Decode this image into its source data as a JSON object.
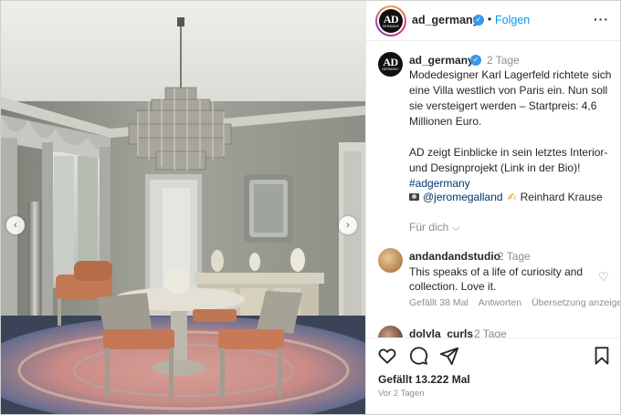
{
  "header": {
    "logo_text": "AD",
    "logo_sub": "GERMANY",
    "username": "ad_germany",
    "verified_mark": "✓",
    "separator": "•",
    "follow_label": "Folgen",
    "more_label": "···"
  },
  "media": {
    "prev_arrow": "‹",
    "next_arrow": "›"
  },
  "caption": {
    "username": "ad_germany",
    "time": "2 Tage",
    "text": "Modedesigner Karl Lagerfeld richtete sich eine Villa westlich von Paris ein. Nun soll sie versteigert werden – Startpreis: 4,6 Millionen Euro.\n\nAD zeigt Einblicke in sein letztes Interior- und Designprojekt (Link in der Bio)!",
    "hashtag": "#adgermany",
    "mention": "@jeromegalland",
    "pen_emoji": "✍",
    "credit_name": "Reinhard Krause",
    "for_you": "Für dich ⌵"
  },
  "comments": [
    {
      "username": "andandandstudio",
      "time": "2 Tage",
      "text": "This speaks of a life of curiosity and collection. Love it.",
      "heart": "♡",
      "likes": "Gefällt 38 Mal",
      "reply": "Antworten",
      "translate": "Übersetzung anzeigen"
    },
    {
      "username": "dolyla_curls",
      "time": "2 Tage"
    }
  ],
  "actions": {
    "likes": "Gefällt 13.222 Mal",
    "date": "Vor 2 Tagen"
  },
  "colors": {
    "accent": "#0095f6",
    "verified": "#3897f0",
    "link": "#00376b",
    "muted": "#8e8e8e"
  },
  "icons": [
    "heart-icon",
    "comment-icon",
    "share-icon",
    "bookmark-icon",
    "more-icon",
    "verified-icon"
  ]
}
